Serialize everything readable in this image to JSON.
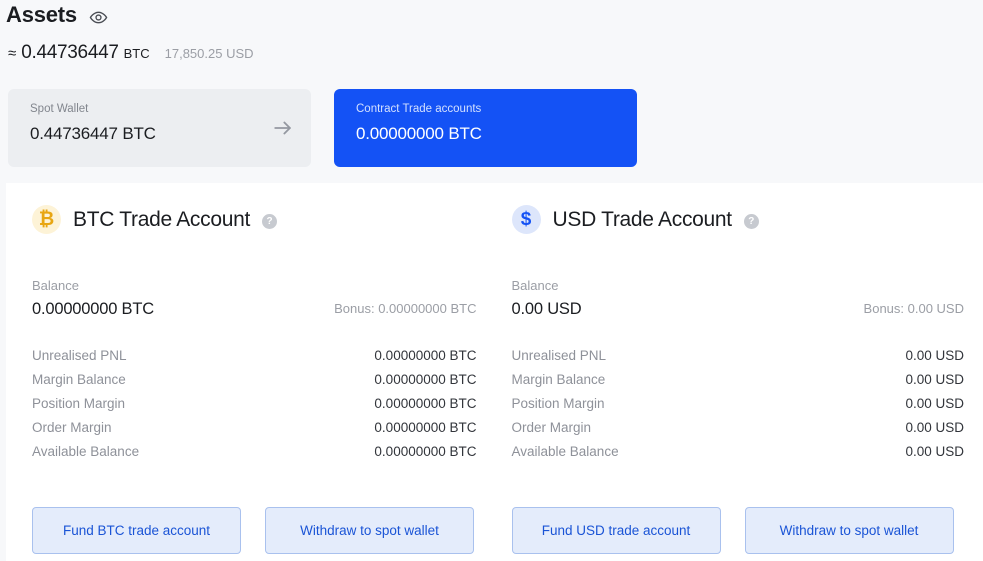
{
  "header": {
    "title": "Assets",
    "visibility_icon": "eye-icon",
    "approx_symbol": "≈",
    "total_btc": "0.44736447",
    "total_btc_unit": "BTC",
    "total_usd": "17,850.25 USD"
  },
  "wallet_cards": [
    {
      "id": "spot-wallet",
      "label": "Spot Wallet",
      "value": "0.44736447 BTC",
      "arrow_icon": "arrow-right-icon",
      "style": "light"
    },
    {
      "id": "contract-trade-accounts",
      "label": "Contract Trade accounts",
      "value": "0.00000000 BTC",
      "style": "blue"
    }
  ],
  "accounts": [
    {
      "id": "btc-trade-account",
      "title": "BTC Trade Account",
      "badge_icon": "bitcoin-icon",
      "badge_symbol": "₿",
      "help_icon": "help-icon",
      "help_symbol": "?",
      "balance_label": "Balance",
      "balance_value": "0.00000000 BTC",
      "bonus": "Bonus: 0.00000000 BTC",
      "stats": [
        {
          "label": "Unrealised PNL",
          "value": "0.00000000 BTC"
        },
        {
          "label": "Margin Balance",
          "value": "0.00000000 BTC"
        },
        {
          "label": "Position Margin",
          "value": "0.00000000 BTC"
        },
        {
          "label": "Order Margin",
          "value": "0.00000000 BTC"
        },
        {
          "label": "Available Balance",
          "value": "0.00000000 BTC"
        }
      ],
      "fund_button": "Fund BTC trade account",
      "withdraw_button": "Withdraw to spot wallet"
    },
    {
      "id": "usd-trade-account",
      "title": "USD Trade Account",
      "badge_icon": "dollar-icon",
      "badge_symbol": "$",
      "help_icon": "help-icon",
      "help_symbol": "?",
      "balance_label": "Balance",
      "balance_value": "0.00 USD",
      "bonus": "Bonus: 0.00 USD",
      "stats": [
        {
          "label": "Unrealised PNL",
          "value": "0.00 USD"
        },
        {
          "label": "Margin Balance",
          "value": "0.00 USD"
        },
        {
          "label": "Position Margin",
          "value": "0.00 USD"
        },
        {
          "label": "Order Margin",
          "value": "0.00 USD"
        },
        {
          "label": "Available Balance",
          "value": "0.00 USD"
        }
      ],
      "fund_button": "Fund USD trade account",
      "withdraw_button": "Withdraw to spot wallet"
    }
  ],
  "colors": {
    "accent_blue": "#1452f5",
    "btc_gold": "#e8a612",
    "page_bg": "#f7f8fa",
    "panel_bg": "#ffffff",
    "muted_text": "#9b9ea5",
    "button_fill": "#e4ecfb",
    "button_border": "#a9c1ee",
    "button_text": "#1a54d6"
  }
}
